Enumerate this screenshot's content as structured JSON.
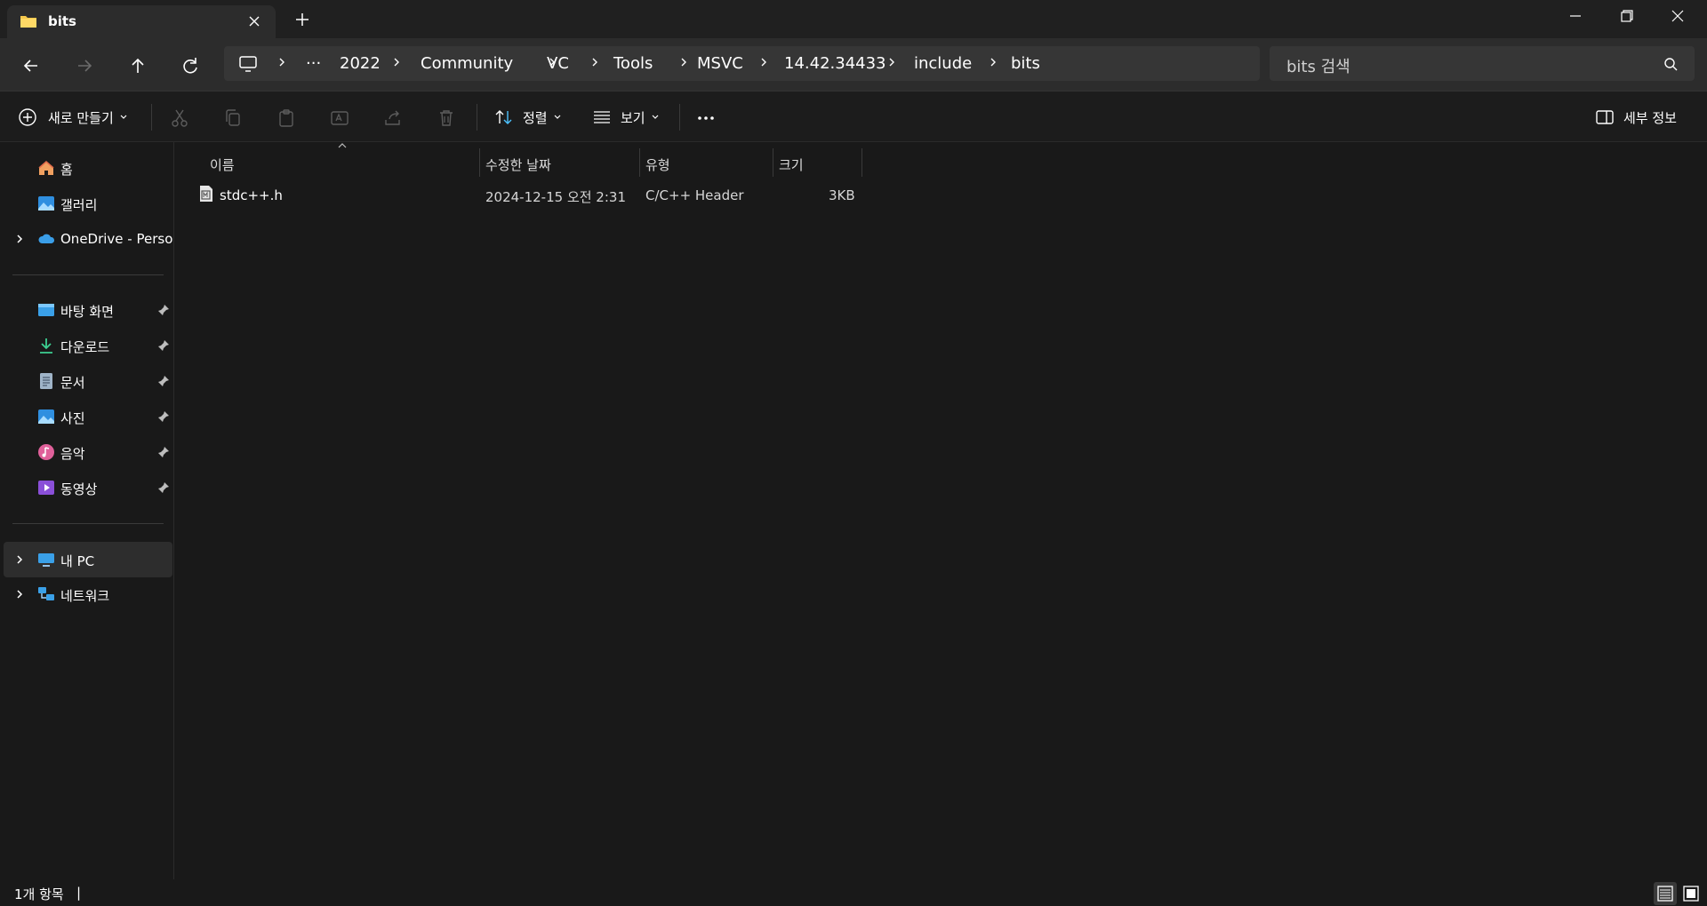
{
  "window": {
    "tab_title": "bits"
  },
  "address": {
    "crumbs": [
      "···",
      "2022",
      "Community",
      "VC",
      "Tools",
      "MSVC",
      "14.42.34433",
      "include",
      "bits"
    ]
  },
  "search": {
    "placeholder": "bits 검색"
  },
  "command_bar": {
    "new_label": "새로 만들기",
    "sort_label": "정렬",
    "view_label": "보기",
    "details_label": "세부 정보"
  },
  "sidebar": {
    "quick": [
      {
        "label": "홈",
        "icon": "home-icon"
      },
      {
        "label": "갤러리",
        "icon": "gallery-icon"
      },
      {
        "label": "OneDrive - Personal",
        "icon": "onedrive-icon"
      }
    ],
    "pinned": [
      {
        "label": "바탕 화면",
        "icon": "desktop-icon"
      },
      {
        "label": "다운로드",
        "icon": "download-icon"
      },
      {
        "label": "문서",
        "icon": "documents-icon"
      },
      {
        "label": "사진",
        "icon": "pictures-icon"
      },
      {
        "label": "음악",
        "icon": "music-icon"
      },
      {
        "label": "동영상",
        "icon": "videos-icon"
      }
    ],
    "devices": [
      {
        "label": "내 PC",
        "icon": "pc-icon"
      },
      {
        "label": "네트워크",
        "icon": "network-icon"
      }
    ]
  },
  "file_list": {
    "columns": [
      "이름",
      "수정한 날짜",
      "유형",
      "크기"
    ],
    "rows": [
      {
        "name": "stdc++.h",
        "modified": "2024-12-15 오전 2:31",
        "type": "C/C++ Header",
        "size": "3KB"
      }
    ]
  },
  "status": {
    "item_count": "1개 항목",
    "separator": "|"
  },
  "colors": {
    "background": "#191919",
    "toolbar": "#2c2c2c",
    "folder": "#f5c84c",
    "accent": "#4cc2ff"
  }
}
